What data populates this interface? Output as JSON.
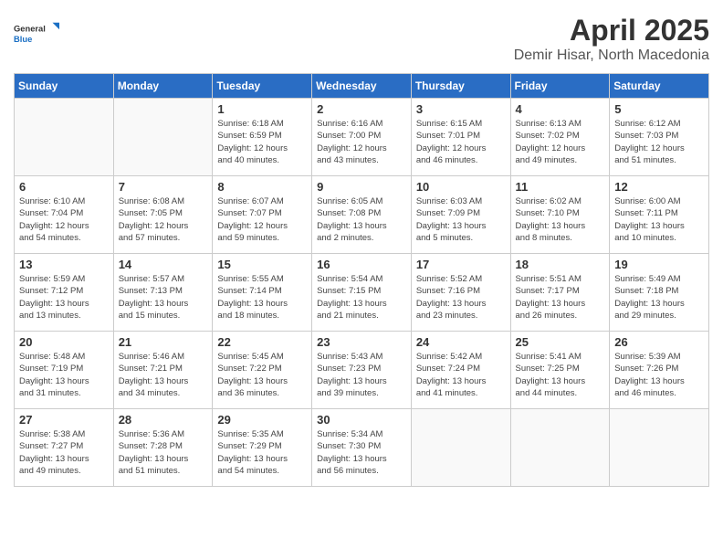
{
  "header": {
    "logo_general": "General",
    "logo_blue": "Blue",
    "month": "April 2025",
    "location": "Demir Hisar, North Macedonia"
  },
  "weekdays": [
    "Sunday",
    "Monday",
    "Tuesday",
    "Wednesday",
    "Thursday",
    "Friday",
    "Saturday"
  ],
  "weeks": [
    [
      {
        "day": "",
        "info": ""
      },
      {
        "day": "",
        "info": ""
      },
      {
        "day": "1",
        "info": "Sunrise: 6:18 AM\nSunset: 6:59 PM\nDaylight: 12 hours\nand 40 minutes."
      },
      {
        "day": "2",
        "info": "Sunrise: 6:16 AM\nSunset: 7:00 PM\nDaylight: 12 hours\nand 43 minutes."
      },
      {
        "day": "3",
        "info": "Sunrise: 6:15 AM\nSunset: 7:01 PM\nDaylight: 12 hours\nand 46 minutes."
      },
      {
        "day": "4",
        "info": "Sunrise: 6:13 AM\nSunset: 7:02 PM\nDaylight: 12 hours\nand 49 minutes."
      },
      {
        "day": "5",
        "info": "Sunrise: 6:12 AM\nSunset: 7:03 PM\nDaylight: 12 hours\nand 51 minutes."
      }
    ],
    [
      {
        "day": "6",
        "info": "Sunrise: 6:10 AM\nSunset: 7:04 PM\nDaylight: 12 hours\nand 54 minutes."
      },
      {
        "day": "7",
        "info": "Sunrise: 6:08 AM\nSunset: 7:05 PM\nDaylight: 12 hours\nand 57 minutes."
      },
      {
        "day": "8",
        "info": "Sunrise: 6:07 AM\nSunset: 7:07 PM\nDaylight: 12 hours\nand 59 minutes."
      },
      {
        "day": "9",
        "info": "Sunrise: 6:05 AM\nSunset: 7:08 PM\nDaylight: 13 hours\nand 2 minutes."
      },
      {
        "day": "10",
        "info": "Sunrise: 6:03 AM\nSunset: 7:09 PM\nDaylight: 13 hours\nand 5 minutes."
      },
      {
        "day": "11",
        "info": "Sunrise: 6:02 AM\nSunset: 7:10 PM\nDaylight: 13 hours\nand 8 minutes."
      },
      {
        "day": "12",
        "info": "Sunrise: 6:00 AM\nSunset: 7:11 PM\nDaylight: 13 hours\nand 10 minutes."
      }
    ],
    [
      {
        "day": "13",
        "info": "Sunrise: 5:59 AM\nSunset: 7:12 PM\nDaylight: 13 hours\nand 13 minutes."
      },
      {
        "day": "14",
        "info": "Sunrise: 5:57 AM\nSunset: 7:13 PM\nDaylight: 13 hours\nand 15 minutes."
      },
      {
        "day": "15",
        "info": "Sunrise: 5:55 AM\nSunset: 7:14 PM\nDaylight: 13 hours\nand 18 minutes."
      },
      {
        "day": "16",
        "info": "Sunrise: 5:54 AM\nSunset: 7:15 PM\nDaylight: 13 hours\nand 21 minutes."
      },
      {
        "day": "17",
        "info": "Sunrise: 5:52 AM\nSunset: 7:16 PM\nDaylight: 13 hours\nand 23 minutes."
      },
      {
        "day": "18",
        "info": "Sunrise: 5:51 AM\nSunset: 7:17 PM\nDaylight: 13 hours\nand 26 minutes."
      },
      {
        "day": "19",
        "info": "Sunrise: 5:49 AM\nSunset: 7:18 PM\nDaylight: 13 hours\nand 29 minutes."
      }
    ],
    [
      {
        "day": "20",
        "info": "Sunrise: 5:48 AM\nSunset: 7:19 PM\nDaylight: 13 hours\nand 31 minutes."
      },
      {
        "day": "21",
        "info": "Sunrise: 5:46 AM\nSunset: 7:21 PM\nDaylight: 13 hours\nand 34 minutes."
      },
      {
        "day": "22",
        "info": "Sunrise: 5:45 AM\nSunset: 7:22 PM\nDaylight: 13 hours\nand 36 minutes."
      },
      {
        "day": "23",
        "info": "Sunrise: 5:43 AM\nSunset: 7:23 PM\nDaylight: 13 hours\nand 39 minutes."
      },
      {
        "day": "24",
        "info": "Sunrise: 5:42 AM\nSunset: 7:24 PM\nDaylight: 13 hours\nand 41 minutes."
      },
      {
        "day": "25",
        "info": "Sunrise: 5:41 AM\nSunset: 7:25 PM\nDaylight: 13 hours\nand 44 minutes."
      },
      {
        "day": "26",
        "info": "Sunrise: 5:39 AM\nSunset: 7:26 PM\nDaylight: 13 hours\nand 46 minutes."
      }
    ],
    [
      {
        "day": "27",
        "info": "Sunrise: 5:38 AM\nSunset: 7:27 PM\nDaylight: 13 hours\nand 49 minutes."
      },
      {
        "day": "28",
        "info": "Sunrise: 5:36 AM\nSunset: 7:28 PM\nDaylight: 13 hours\nand 51 minutes."
      },
      {
        "day": "29",
        "info": "Sunrise: 5:35 AM\nSunset: 7:29 PM\nDaylight: 13 hours\nand 54 minutes."
      },
      {
        "day": "30",
        "info": "Sunrise: 5:34 AM\nSunset: 7:30 PM\nDaylight: 13 hours\nand 56 minutes."
      },
      {
        "day": "",
        "info": ""
      },
      {
        "day": "",
        "info": ""
      },
      {
        "day": "",
        "info": ""
      }
    ]
  ]
}
